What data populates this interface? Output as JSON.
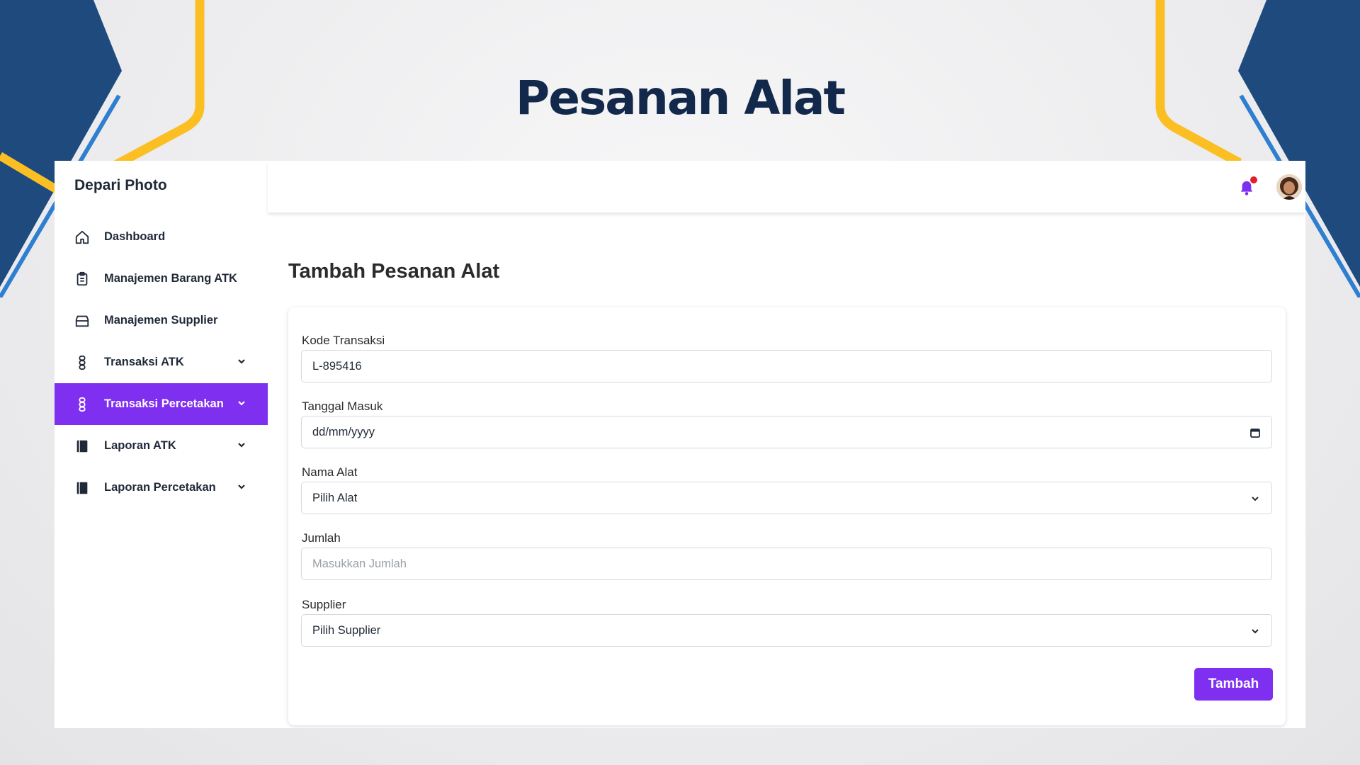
{
  "slide": {
    "title": "Pesanan Alat"
  },
  "app": {
    "brand": "Depari Photo"
  },
  "sidebar": {
    "items": [
      {
        "label": "Dashboard"
      },
      {
        "label": "Manajemen Barang ATK"
      },
      {
        "label": "Manajemen Supplier"
      },
      {
        "label": "Transaksi ATK"
      },
      {
        "label": "Transaksi Percetakan"
      },
      {
        "label": "Laporan ATK"
      },
      {
        "label": "Laporan Percetakan"
      }
    ],
    "active_item": "Transaksi Percetakan"
  },
  "topbar": {
    "notification_dot": true
  },
  "page": {
    "title": "Tambah Pesanan Alat"
  },
  "form": {
    "kode_transaksi": {
      "label": "Kode Transaksi",
      "value": "L-895416"
    },
    "tanggal_masuk": {
      "label": "Tanggal Masuk",
      "value": "dd/mm/yyyy"
    },
    "nama_alat": {
      "label": "Nama Alat",
      "value": "Pilih Alat"
    },
    "jumlah": {
      "label": "Jumlah",
      "placeholder": "Masukkan Jumlah"
    },
    "supplier": {
      "label": "Supplier",
      "value": "Pilih Supplier"
    },
    "submit_label": "Tambah"
  },
  "colors": {
    "accent": "#7e2ff0",
    "title": "#13294b",
    "deco_blue": "#1e4a7e",
    "deco_yellow": "#fbbf24",
    "notification": "#e11d2f"
  }
}
